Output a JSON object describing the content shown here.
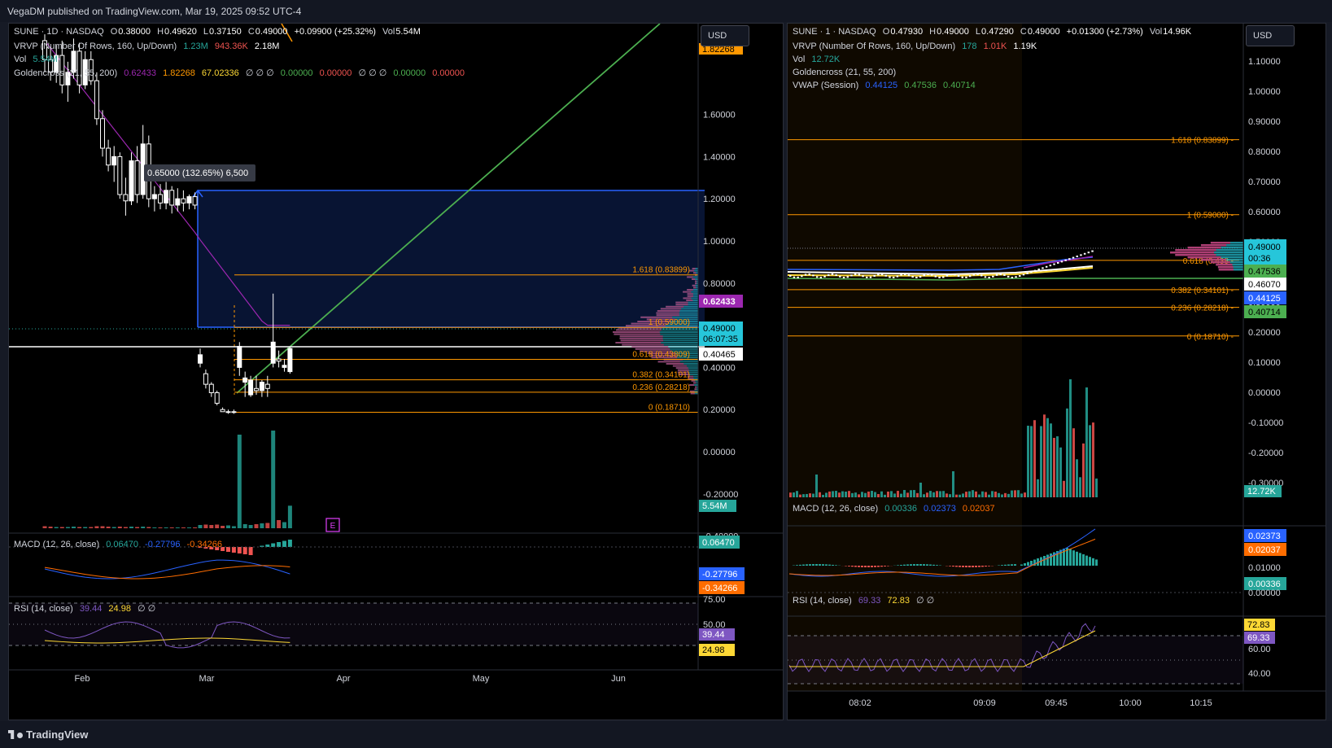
{
  "header": {
    "publish_line": "VegaDM published on TradingView.com, Mar 19, 2025 09:52 UTC-4"
  },
  "footer": {
    "brand": "TradingView"
  },
  "colors": {
    "bg": "#000000",
    "up": "#ffffff",
    "down": "#ffffff",
    "vol_up": "#26a69a",
    "vol_down": "#ef5350",
    "fib": "#ff9800",
    "trend": "#4caf50",
    "measure": "#2962ff",
    "ma": "#9c27b0",
    "macd": "#2962ff",
    "signal": "#ff6d00",
    "rsi": "#7e57c2",
    "rsi_ma": "#fdd835"
  },
  "left_chart": {
    "currency": "USD",
    "legend": {
      "main": {
        "symbol": "SUNE · 1D · NASDAQ",
        "o_label": "O",
        "o": "0.38000",
        "h_label": "H",
        "h": "0.49620",
        "l_label": "L",
        "l": "0.37150",
        "c_label": "C",
        "c": "0.49000",
        "change": "+0.09900 (+25.32%)",
        "vol_label": "Vol",
        "vol": "5.54M"
      },
      "vrvp": {
        "name": "VRVP (Number Of Rows, 160, Up/Down)",
        "v1": "1.23M",
        "v2": "943.36K",
        "v3": "2.18M"
      },
      "vol": {
        "name": "Vol",
        "value": "5.54M"
      },
      "golden": {
        "name": "Goldencross (21, 55, 200)",
        "v1": "0.62433",
        "v2": "1.82268",
        "v3": "67.02336",
        "na": "∅ ∅ ∅",
        "v4": "0.00000",
        "v5": "0.00000",
        "na2": "∅ ∅ ∅",
        "v6": "0.00000",
        "v7": "0.00000"
      }
    },
    "price_axis": [
      "1.60000",
      "1.40000",
      "1.20000",
      "1.00000",
      "0.80000",
      "0.60000",
      "0.40000",
      "0.20000",
      "0.00000",
      "-0.20000",
      "-0.40000"
    ],
    "price_badges": {
      "ma": "0.62433",
      "last": "0.49000",
      "countdown": "06:07:35",
      "line": "0.40465",
      "top_cut": "1.82268",
      "vol": "5.54M"
    },
    "measure_label": "0.65000 (132.65%) 6,500",
    "fib_levels": [
      {
        "label": "1.618 (0.83899)",
        "price": 0.83899
      },
      {
        "label": "1 (0.59000)",
        "price": 0.59
      },
      {
        "label": "0.618 (0.43809)",
        "price": 0.43809
      },
      {
        "label": "0.382 (0.34101)",
        "price": 0.34101
      },
      {
        "label": "0.236 (0.28218)",
        "price": 0.28218
      },
      {
        "label": "0 (0.18710)",
        "price": 0.1871
      }
    ],
    "earnings_marker": "E",
    "time_axis": [
      "Feb",
      "Mar",
      "Apr",
      "May",
      "Jun"
    ],
    "macd": {
      "name": "MACD (12, 26, close)",
      "v1": "0.06470",
      "v2": "-0.27796",
      "v3": "-0.34266",
      "badge_hist": "0.06470",
      "badge_macd": "-0.27796",
      "badge_signal": "-0.34266"
    },
    "rsi": {
      "name": "RSI (14, close)",
      "v1": "39.44",
      "v2": "24.98",
      "na": "∅ ∅",
      "axis": [
        "75.00",
        "50.00",
        "25.00"
      ],
      "badge_rsi": "39.44",
      "badge_ma": "24.98"
    },
    "candles": [
      {
        "o": 1.95,
        "h": 1.98,
        "l": 1.8,
        "c": 1.86
      },
      {
        "o": 1.86,
        "h": 1.92,
        "l": 1.76,
        "c": 1.8
      },
      {
        "o": 1.8,
        "h": 1.93,
        "l": 1.75,
        "c": 1.88
      },
      {
        "o": 1.88,
        "h": 1.95,
        "l": 1.7,
        "c": 1.74
      },
      {
        "o": 1.74,
        "h": 1.85,
        "l": 1.66,
        "c": 1.8
      },
      {
        "o": 1.8,
        "h": 1.96,
        "l": 1.77,
        "c": 1.9
      },
      {
        "o": 1.9,
        "h": 1.94,
        "l": 1.7,
        "c": 1.74
      },
      {
        "o": 1.74,
        "h": 1.9,
        "l": 1.72,
        "c": 1.86
      },
      {
        "o": 1.86,
        "h": 1.9,
        "l": 1.74,
        "c": 1.76
      },
      {
        "o": 1.76,
        "h": 1.8,
        "l": 1.55,
        "c": 1.58
      },
      {
        "o": 1.58,
        "h": 1.62,
        "l": 1.4,
        "c": 1.44
      },
      {
        "o": 1.44,
        "h": 1.48,
        "l": 1.33,
        "c": 1.36
      },
      {
        "o": 1.36,
        "h": 1.45,
        "l": 1.28,
        "c": 1.4
      },
      {
        "o": 1.4,
        "h": 1.42,
        "l": 1.2,
        "c": 1.22
      },
      {
        "o": 1.22,
        "h": 1.3,
        "l": 1.12,
        "c": 1.19
      },
      {
        "o": 1.19,
        "h": 1.42,
        "l": 1.17,
        "c": 1.38
      },
      {
        "o": 1.38,
        "h": 1.45,
        "l": 1.18,
        "c": 1.22
      },
      {
        "o": 1.22,
        "h": 1.55,
        "l": 1.2,
        "c": 1.46
      },
      {
        "o": 1.46,
        "h": 1.5,
        "l": 1.16,
        "c": 1.2
      },
      {
        "o": 1.2,
        "h": 1.26,
        "l": 1.14,
        "c": 1.22
      },
      {
        "o": 1.22,
        "h": 1.27,
        "l": 1.15,
        "c": 1.18
      },
      {
        "o": 1.18,
        "h": 1.28,
        "l": 1.15,
        "c": 1.24
      },
      {
        "o": 1.24,
        "h": 1.26,
        "l": 1.13,
        "c": 1.17
      },
      {
        "o": 1.17,
        "h": 1.25,
        "l": 1.14,
        "c": 1.2
      },
      {
        "o": 1.2,
        "h": 1.24,
        "l": 1.14,
        "c": 1.18
      },
      {
        "o": 1.18,
        "h": 1.22,
        "l": 1.15,
        "c": 1.21
      },
      {
        "o": 1.21,
        "h": 1.23,
        "l": 1.15,
        "c": 1.17
      },
      {
        "o": 0.42,
        "h": 0.49,
        "l": 0.4,
        "c": 0.46
      },
      {
        "o": 0.37,
        "h": 0.39,
        "l": 0.3,
        "c": 0.32
      },
      {
        "o": 0.32,
        "h": 0.33,
        "l": 0.26,
        "c": 0.28
      },
      {
        "o": 0.28,
        "h": 0.29,
        "l": 0.22,
        "c": 0.23
      },
      {
        "o": 0.2,
        "h": 0.21,
        "l": 0.19,
        "c": 0.19
      },
      {
        "o": 0.19,
        "h": 0.2,
        "l": 0.18,
        "c": 0.19
      },
      {
        "o": 0.19,
        "h": 0.2,
        "l": 0.18,
        "c": 0.19
      },
      {
        "o": 0.4,
        "h": 0.52,
        "l": 0.36,
        "c": 0.5
      },
      {
        "o": 0.33,
        "h": 0.38,
        "l": 0.26,
        "c": 0.35
      },
      {
        "o": 0.27,
        "h": 0.36,
        "l": 0.26,
        "c": 0.34
      },
      {
        "o": 0.3,
        "h": 0.36,
        "l": 0.27,
        "c": 0.29
      },
      {
        "o": 0.29,
        "h": 0.34,
        "l": 0.26,
        "c": 0.33
      },
      {
        "o": 0.32,
        "h": 0.36,
        "l": 0.26,
        "c": 0.3
      },
      {
        "o": 0.42,
        "h": 0.75,
        "l": 0.4,
        "c": 0.52
      },
      {
        "o": 0.44,
        "h": 0.48,
        "l": 0.4,
        "c": 0.43
      },
      {
        "o": 0.4,
        "h": 0.44,
        "l": 0.38,
        "c": 0.41
      },
      {
        "o": 0.38,
        "h": 0.5,
        "l": 0.37,
        "c": 0.49
      }
    ],
    "volumes_m": [
      0.5,
      0.4,
      0.3,
      0.3,
      0.3,
      0.4,
      0.3,
      0.3,
      0.3,
      0.5,
      0.5,
      0.4,
      0.3,
      0.4,
      0.3,
      0.4,
      0.3,
      0.4,
      0.3,
      0.2,
      0.2,
      0.2,
      0.2,
      0.2,
      0.2,
      0.2,
      0.2,
      0.8,
      0.9,
      0.8,
      0.9,
      0.6,
      0.7,
      0.5,
      23.0,
      1.0,
      0.8,
      1.0,
      1.2,
      1.3,
      24.0,
      2.0,
      1.5,
      5.54
    ]
  },
  "right_chart": {
    "currency": "USD",
    "legend": {
      "main": {
        "symbol": "SUNE · 1 · NASDAQ",
        "o_label": "O",
        "o": "0.47930",
        "h_label": "H",
        "h": "0.49000",
        "l_label": "L",
        "l": "0.47290",
        "c_label": "C",
        "c": "0.49000",
        "change": "+0.01300 (+2.73%)",
        "vol_label": "Vol",
        "vol": "14.96K"
      },
      "vrvp": {
        "name": "VRVP (Number Of Rows, 160, Up/Down)",
        "v1": "178",
        "v2": "1.01K",
        "v3": "1.19K"
      },
      "vol": {
        "name": "Vol",
        "value": "12.72K"
      },
      "golden": {
        "name": "Goldencross (21, 55, 200)"
      },
      "vwap": {
        "name": "VWAP (Session)",
        "v1": "0.44125",
        "v2": "0.47536",
        "v3": "0.40714"
      }
    },
    "price_axis": [
      "1.10000",
      "1.00000",
      "0.90000",
      "0.80000",
      "0.70000",
      "0.60000",
      "0.50000",
      "0.40000",
      "0.30000",
      "0.20000",
      "0.10000",
      "0.00000",
      "-0.10000",
      "-0.20000",
      "-0.30000"
    ],
    "price_badges": {
      "last": "0.49000",
      "countdown": "00:36",
      "vwap_up": "0.47536",
      "ma": "0.46070",
      "vwap": "0.44125",
      "vwap_low": "0.40714",
      "vol": "12.72K"
    },
    "fib_levels": [
      {
        "label": "1.618 (0.83899)",
        "price": 0.83899
      },
      {
        "label": "1 (0.59000)",
        "price": 0.59
      },
      {
        "label": "0.618 (0.438",
        "price": 0.43809
      },
      {
        "label": "0.382 (0.34101)",
        "price": 0.34101
      },
      {
        "label": "0.236 (0.28218)",
        "price": 0.28218
      },
      {
        "label": "0 (0.18710)",
        "price": 0.1871
      }
    ],
    "time_axis": [
      "08:02",
      "09:09",
      "09:45",
      "10:00",
      "10:15"
    ],
    "macd": {
      "name": "MACD (12, 26, close)",
      "v1": "0.00336",
      "v2": "0.02373",
      "v3": "0.02037",
      "axis": [
        "0.01000",
        "0.00000"
      ],
      "badge_macd": "0.02373",
      "badge_signal": "0.02037",
      "badge_hist": "0.00336"
    },
    "rsi": {
      "name": "RSI (14, close)",
      "v1": "69.33",
      "v2": "72.83",
      "na": "∅ ∅",
      "axis": [
        "60.00",
        "40.00"
      ],
      "badge_ma": "72.83",
      "badge_rsi": "69.33"
    }
  }
}
